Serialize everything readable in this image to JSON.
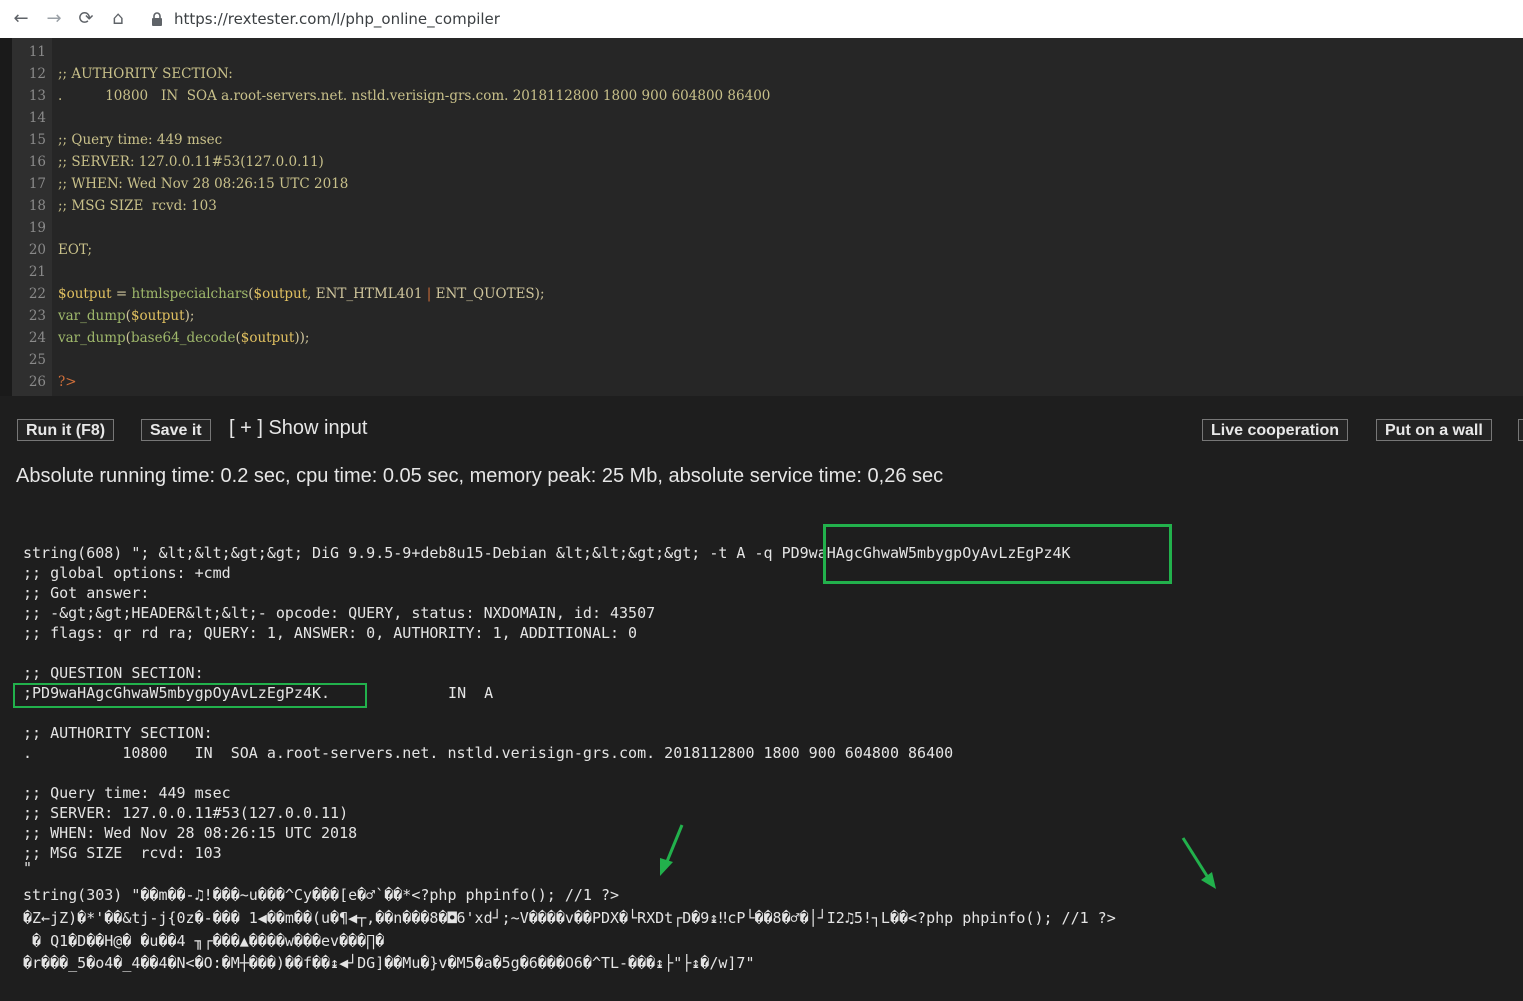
{
  "browser": {
    "back": "←",
    "forward": "→",
    "reload": "⟳",
    "home": "⌂",
    "url": "https://rextester.com/l/php_online_compiler"
  },
  "editor": {
    "lines": [
      {
        "num": "11",
        "text": ""
      },
      {
        "num": "12",
        "text": ";; AUTHORITY SECTION:"
      },
      {
        "num": "13",
        "text": ".          10800   IN  SOA a.root-servers.net. nstld.verisign-grs.com. 2018112800 1800 900 604800 86400"
      },
      {
        "num": "14",
        "text": ""
      },
      {
        "num": "15",
        "text": ";; Query time: 449 msec"
      },
      {
        "num": "16",
        "text": ";; SERVER: 127.0.0.11#53(127.0.0.11)"
      },
      {
        "num": "17",
        "text": ";; WHEN: Wed Nov 28 08:26:15 UTC 2018"
      },
      {
        "num": "18",
        "text": ";; MSG SIZE  rcvd: 103"
      },
      {
        "num": "19",
        "text": ""
      },
      {
        "num": "20",
        "text": "EOT;"
      },
      {
        "num": "21",
        "text": ""
      },
      {
        "num": "22",
        "parts": {
          "a": "$output",
          "b": " = ",
          "c": "htmlspecialchars",
          "d": "(",
          "e": "$output",
          "f": ", ENT_HTML401 ",
          "g": "|",
          "h": " ENT_QUOTES);"
        }
      },
      {
        "num": "23",
        "parts": {
          "a": "var_dump",
          "b": "(",
          "c": "$output",
          "d": ");"
        }
      },
      {
        "num": "24",
        "parts": {
          "a": "var_dump",
          "b": "(",
          "c": "base64_decode",
          "d": "(",
          "e": "$output",
          "f": "));"
        }
      },
      {
        "num": "25",
        "text": ""
      },
      {
        "num": "26",
        "text": "?>"
      }
    ]
  },
  "toolbar": {
    "run_label": "Run it (F8)",
    "save_label": "Save it",
    "show_input_label": "[ + ] Show input",
    "live_label": "Live cooperation",
    "wall_label": "Put on a wall"
  },
  "stats": "Absolute running time: 0.2 sec, cpu time: 0.05 sec, memory peak: 25 Mb, absolute service time: 0,26 sec",
  "output": {
    "l1a": "string(608) \"; &lt;&lt;&gt;&gt; DiG 9.9.5-9+deb8u15-Debian &lt;&lt;&gt;&gt; -t A -q ",
    "l1b": "PD9waHAgcGhwaW5mbygpOyAvLzEgPz4K",
    "l2": ";; global options: +cmd",
    "l3": ";; Got answer:",
    "l4": ";; -&gt;&gt;HEADER&lt;&lt;- opcode: QUERY, status: NXDOMAIN, id: 43507",
    "l5": ";; flags: qr rd ra; QUERY: 1, ANSWER: 0, AUTHORITY: 1, ADDITIONAL: 0",
    "l6": ";; QUESTION SECTION:",
    "l7a": ";PD9waHAgcGhwaW5mbygpOyAvLzEgPz4K.",
    "l7b": "IN  A",
    "l8": ";; AUTHORITY SECTION:",
    "l9": ".          10800   IN  SOA a.root-servers.net. nstld.verisign-grs.com. 2018112800 1800 900 604800 86400",
    "l10": ";; Query time: 449 msec",
    "l11": ";; SERVER: 127.0.0.11#53(127.0.0.11)",
    "l12": ";; WHEN: Wed Nov 28 08:26:15 UTC 2018",
    "l13": ";; MSG SIZE  rcvd: 103",
    "l14": "\"",
    "l15": "string(303) \"��m��-♫!���~u���^Cy���[e�♂`��*<?php phpinfo(); //1 ?>",
    "l16": "�Z←jZ)�*'��&tj-j{0z�-��� 1◀��m��(u�¶◀┬,��n���8�◘6'xd┘;~V����v��PDX�└RXDt┌D�9↨‼cP└��8�♂�│┘I2♫5!┐L��<?php phpinfo(); //1 ?>",
    "l17": " � Q1�D��H@� �u��4 ╖┌���▲����w���ev���∏�",
    "l18": "�r���_5�o4�_4��4�N<�O:�M┼���)��f��↨◀┘DG]��Mu�}v�M5�a�5g�6���O6�^TL-���↨├\"├↨�/w]7\""
  }
}
